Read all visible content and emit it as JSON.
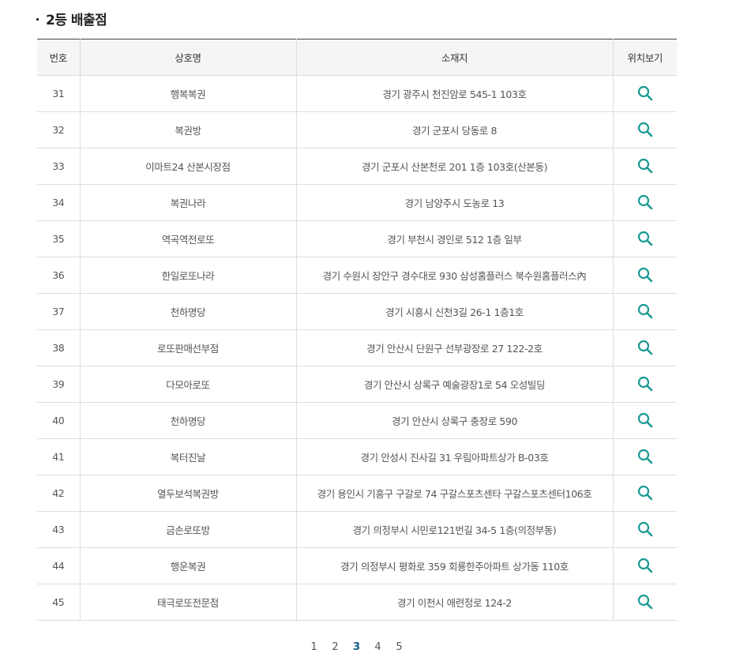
{
  "section": {
    "title": "2등 배출점"
  },
  "table": {
    "headers": {
      "number": "번호",
      "name": "상호명",
      "address": "소재지",
      "map": "위치보기"
    },
    "rows": [
      {
        "number": "31",
        "name": "행복복권",
        "address": "경기 광주시 천진암로 545-1 103호"
      },
      {
        "number": "32",
        "name": "복권방",
        "address": "경기 군포시 당동로 8"
      },
      {
        "number": "33",
        "name": "이마트24 산본시장점",
        "address": "경기 군포시 산본천로 201 1층 103호(산본동)"
      },
      {
        "number": "34",
        "name": "복권나라",
        "address": "경기 남양주시 도농로 13"
      },
      {
        "number": "35",
        "name": "역곡역전로또",
        "address": "경기 부천시 경인로 512 1층 일부"
      },
      {
        "number": "36",
        "name": "한일로또나라",
        "address": "경기 수원시 장안구 경수대로 930 삼성홈플러스 북수원홈플러스內"
      },
      {
        "number": "37",
        "name": "천하명당",
        "address": "경기 시흥시 신천3길 26-1 1층1호"
      },
      {
        "number": "38",
        "name": "로또판매선부점",
        "address": "경기 안산시 단원구 선부광장로 27 122-2호"
      },
      {
        "number": "39",
        "name": "다모아로또",
        "address": "경기 안산시 상록구 예술광장1로 54 오성빌딩"
      },
      {
        "number": "40",
        "name": "천하명당",
        "address": "경기 안산시 상록구 충장로 590"
      },
      {
        "number": "41",
        "name": "복터진날",
        "address": "경기 안성시 진사길 31 우림아파트상가 B-03호"
      },
      {
        "number": "42",
        "name": "열두보석복권방",
        "address": "경기 용인시 기흥구 구갈로 74 구갈스포츠센타 구갈스포츠센터106호"
      },
      {
        "number": "43",
        "name": "금손로또방",
        "address": "경기 의정부시 시민로121번길 34-5 1층(의정부동)"
      },
      {
        "number": "44",
        "name": "행운복권",
        "address": "경기 의정부시 평화로 359 회룡한주아파트 상가동 110호"
      },
      {
        "number": "45",
        "name": "태극로또전문점",
        "address": "경기 이천시 애련정로 124-2"
      }
    ],
    "map_icon": "search-icon",
    "icon_color": "#1a9a93"
  },
  "pagination": {
    "pages": [
      "1",
      "2",
      "3",
      "4",
      "5"
    ],
    "current": "3"
  }
}
